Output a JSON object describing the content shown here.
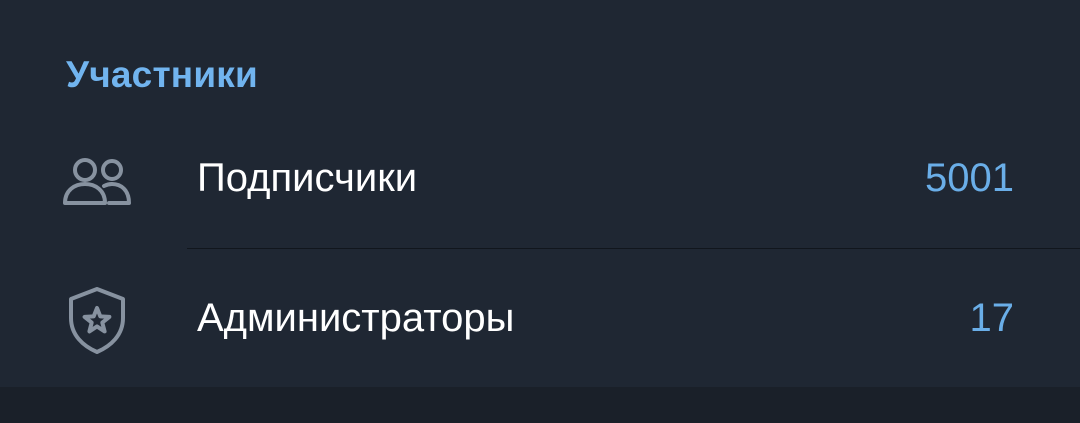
{
  "section": {
    "title": "Участники"
  },
  "rows": [
    {
      "icon": "people-icon",
      "label": "Подписчики",
      "count": "5001"
    },
    {
      "icon": "admin-shield-star-icon",
      "label": "Администраторы",
      "count": "17"
    }
  ],
  "colors": {
    "header_accent": "#71b4ef",
    "count_accent": "#6aaee8",
    "background": "#1f2733",
    "icon": "#8792a0"
  }
}
